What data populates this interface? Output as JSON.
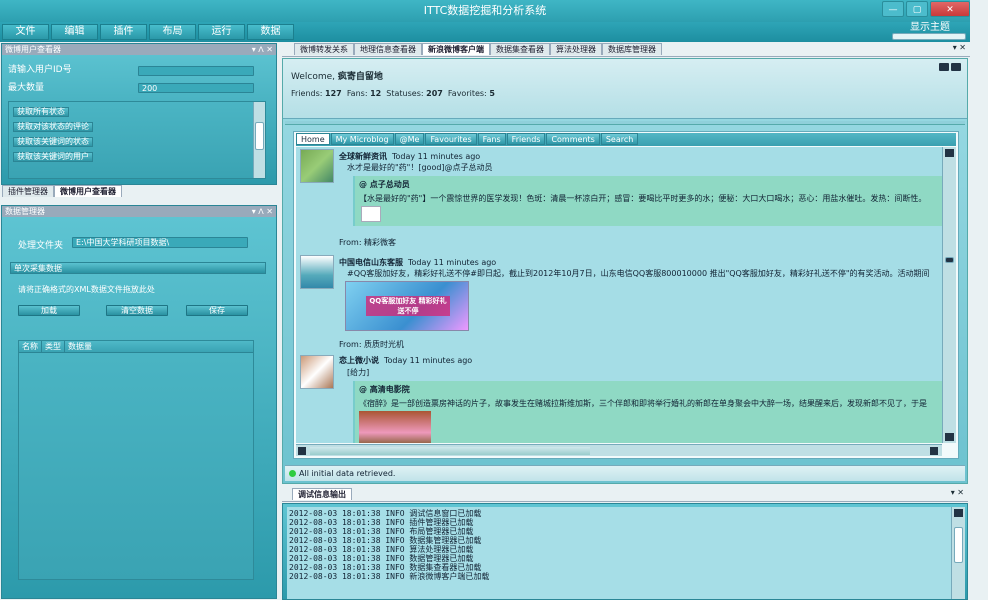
{
  "window": {
    "title": "ITTC数据挖掘和分析系统",
    "min": "—",
    "max": "▢",
    "close": "✕"
  },
  "menu": [
    "文件",
    "编辑",
    "插件",
    "布局",
    "运行",
    "数据"
  ],
  "theme_label": "显示主题",
  "weibo_panel": {
    "title": "微博用户查看器",
    "controls": "▾ ᐱ ✕",
    "user_id_label": "请输入用户ID号",
    "user_id_value": "",
    "max_count_label": "最大数量",
    "max_count_value": "200",
    "actions": [
      "获取所有状态",
      "获取对该状态的评论",
      "获取该关键词的状态",
      "获取该关键词的用户"
    ]
  },
  "left_tabs": [
    "插件管理器",
    "微博用户查看器"
  ],
  "data_panel": {
    "title": "数据管理器",
    "controls": "▾ ᐱ ✕",
    "folder_label": "处理文件夹",
    "folder_value": "E:\\中国大学科研项目数据\\",
    "group_title": "单次采集数据",
    "hint": "请将正确格式的XML数据文件拖放此处",
    "buttons": [
      "加载",
      "清空数据",
      "保存"
    ],
    "columns": [
      "名称",
      "类型",
      "数据量"
    ]
  },
  "doc_tabs": [
    "微博转发关系",
    "地理信息查看器",
    "新浪微博客户端",
    "数据集查看器",
    "算法处理器",
    "数据库管理器"
  ],
  "doc_active": 2,
  "client": {
    "welcome_prefix": "Welcome,",
    "username": "疯寄自留地",
    "stats": [
      {
        "label": "Friends:",
        "value": "127"
      },
      {
        "label": "Fans:",
        "value": "12"
      },
      {
        "label": "Statuses:",
        "value": "207"
      },
      {
        "label": "Favorites:",
        "value": "5"
      }
    ],
    "feed_tabs": [
      "Home",
      "My Microblog",
      "@Me",
      "Favourites",
      "Fans",
      "Friends",
      "Comments",
      "Search"
    ],
    "feed_active": 0,
    "posts": [
      {
        "user": "全球新鲜资讯",
        "time": "Today 11 minutes ago",
        "text": "水才是最好的\"药\"！[good]@点子总动员",
        "quote_user": "@ 点子总动员",
        "quote_text": "【水是最好的\"药\"】一个震惊世界的医学发现！色斑：清晨一杯凉白开；感冒：要喝比平时更多的水；便秘：大口大口喝水；恶心：用盐水催吐。发热：间断性。",
        "from": "From:  精彩微客"
      },
      {
        "user": "中国电信山东客服",
        "time": "Today 11 minutes ago",
        "text": "#QQ客服加好友，精彩好礼送不停#即日起，截止到2012年10月7日，山东电信QQ客服800010000 推出\"QQ客服加好友，精彩好礼送不停\"的有奖活动。活动期间",
        "banner_title": "QQ客服加好友 精彩好礼送不停",
        "from": "From:  质质时光机"
      },
      {
        "user": "恋上微小说",
        "time": "Today 11 minutes ago",
        "text": "[给力]",
        "quote_user": "@ 高清电影院",
        "quote_text": "《宿醉》是一部创造票房神话的片子，故事发生在赌城拉斯维加斯，三个伴郎和即将举行婚礼的新郎在单身聚会中大醉一场，结果醒来后，发现新郎不见了，于是"
      }
    ],
    "status": "All initial data retrieved."
  },
  "debug": {
    "title": "调试信息输出",
    "controls": "▾ ✕",
    "lines": [
      "2012-08-03 18:01:38 INFO  调试信息窗口已加载",
      "2012-08-03 18:01:38 INFO  插件管理器已加载",
      "2012-08-03 18:01:38 INFO  布局管理器已加载",
      "2012-08-03 18:01:38 INFO  数据集管理器已加载",
      "2012-08-03 18:01:38 INFO  算法处理器已加载",
      "2012-08-03 18:01:38 INFO  数据管理器已加载",
      "2012-08-03 18:01:38 INFO  数据集查看器已加载",
      "2012-08-03 18:01:38 INFO  新浪微博客户端已加载"
    ]
  },
  "colors": {
    "accent": "#2ea5b7",
    "panel_bg": "#5fc5d3",
    "quote_bg": "#8fd9c4",
    "status_dot": "#2ecc40"
  }
}
